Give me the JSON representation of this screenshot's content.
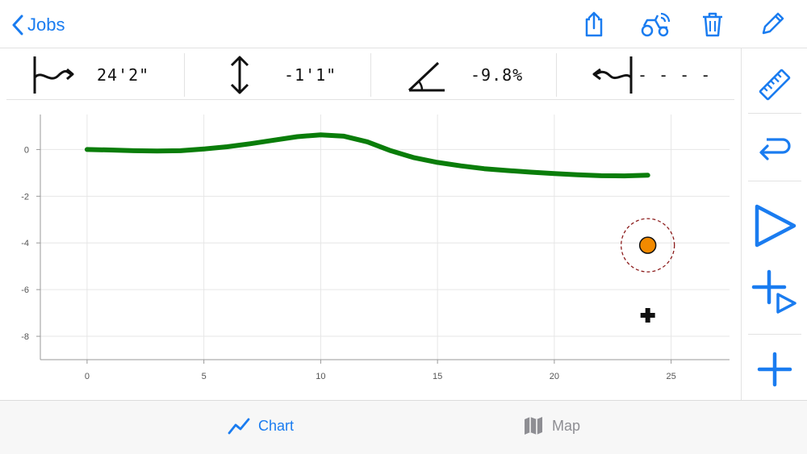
{
  "header": {
    "back_label": "Jobs",
    "icons": [
      "share-icon",
      "tractor-signal-icon",
      "trash-icon",
      "pencil-icon"
    ]
  },
  "stats": [
    {
      "icon": "distance-icon",
      "value": "24'2\""
    },
    {
      "icon": "vertical-change-icon",
      "value": "-1'1\""
    },
    {
      "icon": "slope-angle-icon",
      "value": "-9.8%"
    },
    {
      "icon": "remaining-distance-icon",
      "value": "- - - -"
    }
  ],
  "sidebar": {
    "icons": [
      "ruler-icon",
      "return-arrow-icon",
      "play-icon",
      "add-play-icon",
      "add-icon"
    ]
  },
  "tabs": [
    {
      "label": "Chart",
      "icon": "chart-icon",
      "active": true
    },
    {
      "label": "Map",
      "icon": "map-icon",
      "active": false
    }
  ],
  "colors": {
    "accent": "#1a7cf0",
    "line": "#0a7d0a",
    "marker": "#f28a00",
    "inactive": "#8e8e93"
  },
  "chart_data": {
    "type": "line",
    "xlim": [
      -2,
      27.5
    ],
    "ylim": [
      -9,
      1.5
    ],
    "x_ticks": [
      0,
      5,
      10,
      15,
      20,
      25
    ],
    "y_ticks": [
      0,
      -2,
      -4,
      -6,
      -8
    ],
    "grid": true,
    "series": [
      {
        "x": [
          0,
          1,
          2,
          3,
          4,
          5,
          6,
          7,
          8,
          9,
          10,
          11,
          12,
          13,
          14,
          15,
          16,
          17,
          18,
          19,
          20,
          21,
          22,
          23,
          24
        ],
        "y": [
          0,
          -0.02,
          -0.05,
          -0.06,
          -0.05,
          0.02,
          0.12,
          0.25,
          0.4,
          0.55,
          0.63,
          0.57,
          0.33,
          -0.05,
          -0.35,
          -0.55,
          -0.7,
          -0.82,
          -0.9,
          -0.97,
          -1.03,
          -1.08,
          -1.12,
          -1.13,
          -1.1
        ]
      }
    ],
    "marker_target": {
      "x": 24,
      "y": -4.1
    },
    "marker_cross": {
      "x": 24,
      "y": -7.1
    }
  }
}
